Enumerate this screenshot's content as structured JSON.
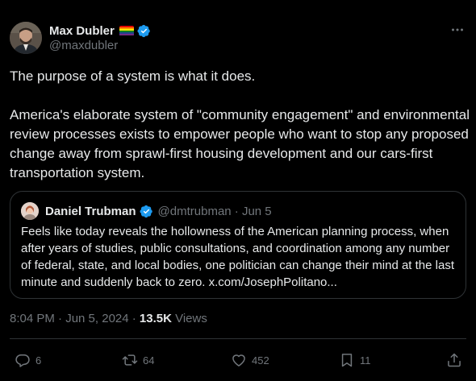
{
  "author": {
    "display_name": "Max Dubler",
    "handle": "@maxdubler",
    "flag_colors": [
      "#e40303",
      "#ff8c00",
      "#ffed00",
      "#008026",
      "#24408e",
      "#732982"
    ]
  },
  "tweet": {
    "paragraph_1": "The purpose of a system is what it does.",
    "paragraph_2": "America's elaborate system of \"community engagement\" and environmental review processes exists to empower people who want to stop any proposed change away from sprawl-first housing development and our cars-first transportation system."
  },
  "quoted_tweet": {
    "display_name": "Daniel Trubman",
    "handle_date": "@dmtrubman · Jun 5",
    "text": "Feels like today reveals the hollowness of the American planning process, when after years of studies, public consultations, and coordination among any number of federal, state, and local bodies, one politician can change their mind at the last minute and suddenly back to zero. x.com/JosephPolitano..."
  },
  "meta": {
    "timestamp": "8:04 PM · Jun 5, 2024 · ",
    "views_count": "13.5K",
    "views_label": " Views"
  },
  "actions": {
    "replies": "6",
    "retweets": "64",
    "likes": "452",
    "bookmarks": "11"
  },
  "colors": {
    "background": "#000000",
    "text": "#e7e9ea",
    "muted": "#71767b",
    "border": "#2f3336",
    "verified": "#1d9bf0"
  }
}
